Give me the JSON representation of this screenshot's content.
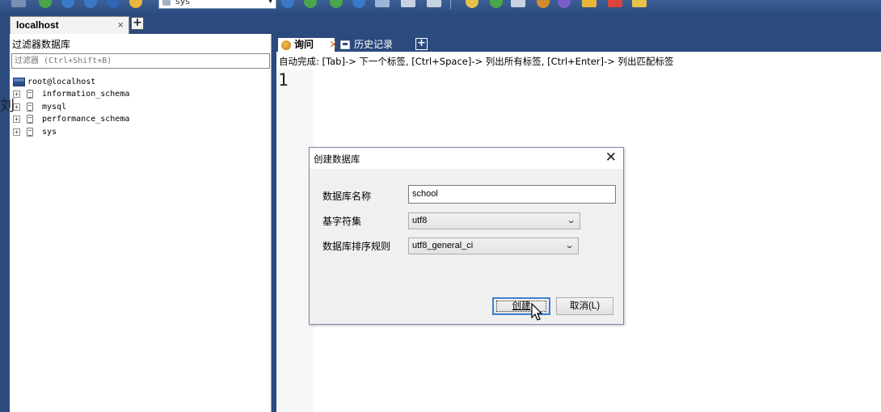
{
  "toolbar": {
    "database_select": {
      "value": "sys"
    }
  },
  "connection_tab": {
    "label": "localhost",
    "close": "×",
    "add": "+"
  },
  "object_browser": {
    "title": "过滤器数据库",
    "filter_placeholder": "过滤器 (Ctrl+Shift+B)",
    "root": "root@localhost",
    "databases": [
      "information_schema",
      "mysql",
      "performance_schema",
      "sys"
    ],
    "expander": "+",
    "stray_glyph": "刘"
  },
  "query_tabs": {
    "query_label": "询问",
    "query_close": "×",
    "history_label": "历史记录",
    "add": "+"
  },
  "editor": {
    "autocomplete_hint": "自动完成: [Tab]-> 下一个标签, [Ctrl+Space]-> 列出所有标签, [Ctrl+Enter]-> 列出匹配标签",
    "line_number": "1"
  },
  "dialog": {
    "title": "创建数据库",
    "close": "✕",
    "name_label": "数据库名称",
    "name_value": "school",
    "charset_label": "基字符集",
    "charset_value": "utf8",
    "collation_label": "数据库排序规则",
    "collation_value": "utf8_general_ci",
    "create_button": "创建",
    "cancel_button": "取消(L)"
  },
  "colors": {
    "app_background": "#2b4a7e",
    "focus_blue": "#3c7fd1"
  },
  "icons": {
    "server": "server-icon",
    "database": "database-icon",
    "query": "query-icon",
    "history": "history-icon",
    "cursor": "mouse-cursor-icon"
  }
}
